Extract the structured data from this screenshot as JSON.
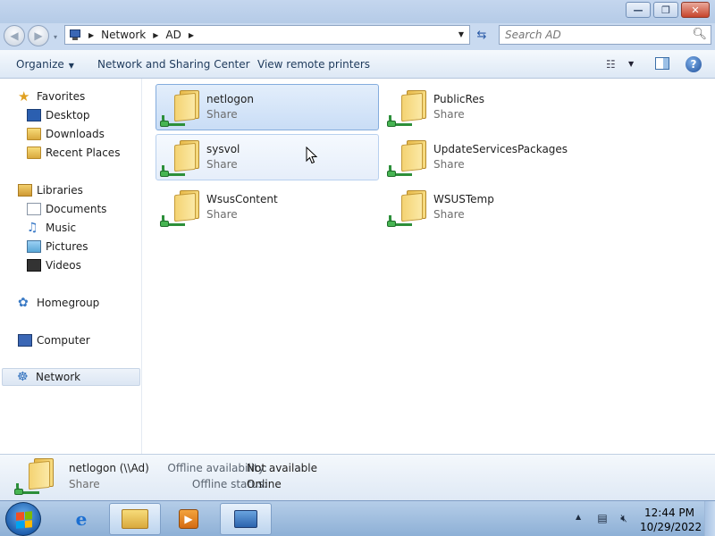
{
  "window": {
    "minimize_glyph": "—",
    "restore_glyph": "❐",
    "close_glyph": "✕"
  },
  "nav": {
    "back_glyph": "◀",
    "forward_glyph": "▶",
    "dropdown_glyph": "▾"
  },
  "address": {
    "breadcrumb": [
      "Network",
      "AD"
    ],
    "separator_glyph": "▶",
    "dropdown_glyph": "▼",
    "refresh_glyph": "⇆"
  },
  "search": {
    "placeholder": "Search AD",
    "icon": "magnifier-icon"
  },
  "commandbar": {
    "organize_label": "Organize",
    "organize_dd": "▼",
    "network_sharing_label": "Network and Sharing Center",
    "remote_printers_label": "View remote printers",
    "views_dd": "▼",
    "help_glyph": "?"
  },
  "navpane": {
    "favorites": "Favorites",
    "desktop": "Desktop",
    "downloads": "Downloads",
    "recent_places": "Recent Places",
    "libraries": "Libraries",
    "documents": "Documents",
    "music": "Music",
    "pictures": "Pictures",
    "videos": "Videos",
    "homegroup": "Homegroup",
    "computer": "Computer",
    "network": "Network",
    "selected": "Network"
  },
  "shares": [
    {
      "name": "netlogon",
      "type": "Share"
    },
    {
      "name": "PublicRes",
      "type": "Share"
    },
    {
      "name": "sysvol",
      "type": "Share"
    },
    {
      "name": "UpdateServicesPackages",
      "type": "Share"
    },
    {
      "name": "WsusContent",
      "type": "Share"
    },
    {
      "name": "WSUSTemp",
      "type": "Share"
    }
  ],
  "selected_share": "netlogon",
  "hovered_share": "sysvol",
  "details": {
    "name": "netlogon (\\\\Ad)",
    "type": "Share",
    "offline_availability_label": "Offline availability:",
    "offline_availability_value": "Not available",
    "offline_status_label": "Offline status:",
    "offline_status_value": "Online"
  },
  "taskbar": {
    "tray_arrow": "▲",
    "time": "12:44 PM",
    "date": "10/29/2022"
  },
  "colors": {
    "accent": "#3b6ea8",
    "selection": "#c9ddf6",
    "titlebar": "#c4d6ee"
  }
}
